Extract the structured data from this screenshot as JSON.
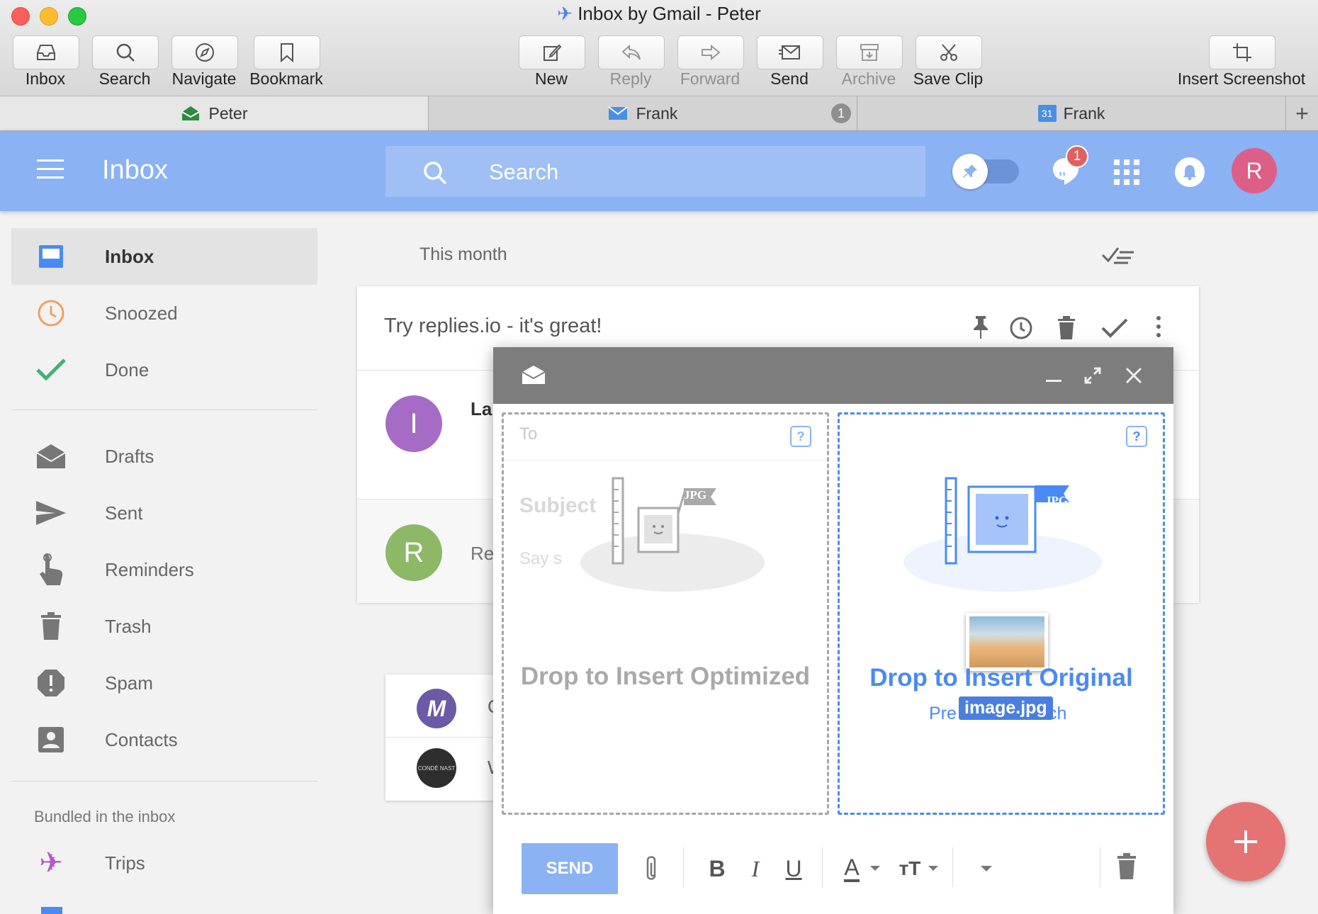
{
  "window": {
    "title": "Inbox by Gmail - Peter"
  },
  "toolbar": {
    "inbox": "Inbox",
    "search": "Search",
    "navigate": "Navigate",
    "bookmark": "Bookmark",
    "new": "New",
    "reply": "Reply",
    "forward": "Forward",
    "send": "Send",
    "archive": "Archive",
    "save_clip": "Save Clip",
    "insert_screenshot": "Insert Screenshot"
  },
  "tabs": [
    {
      "label": "Peter"
    },
    {
      "label": "Frank",
      "badge": "1"
    },
    {
      "label": "Frank",
      "cal_day": "31"
    }
  ],
  "header": {
    "title": "Inbox",
    "search_placeholder": "Search",
    "chat_badge": "1",
    "avatar": "R"
  },
  "sidebar": {
    "items": [
      {
        "label": "Inbox"
      },
      {
        "label": "Snoozed"
      },
      {
        "label": "Done"
      },
      {
        "label": "Drafts"
      },
      {
        "label": "Sent"
      },
      {
        "label": "Reminders"
      },
      {
        "label": "Trash"
      },
      {
        "label": "Spam"
      },
      {
        "label": "Contacts"
      }
    ],
    "section_title": "Bundled in the inbox",
    "bundles": [
      {
        "label": "Trips"
      }
    ]
  },
  "main": {
    "section": "This month",
    "card_subject": "Try replies.io - it's great!",
    "rows": [
      {
        "avatar": "I",
        "snippet": "La"
      },
      {
        "avatar": "R",
        "snippet": "Re"
      }
    ],
    "list2": [
      {
        "snippet": "C"
      },
      {
        "avatar_text": "CONDÉ NAST",
        "snippet": "W"
      }
    ]
  },
  "compose": {
    "to_placeholder": "To",
    "subject_placeholder": "Subject",
    "body_placeholder": "Say s",
    "help": "?",
    "jpg_tag": "JPG",
    "drop_optimized": "Drop to Insert Optimized",
    "drop_original": "Drop to Insert Original",
    "drop_hint_left": "Pre",
    "drop_hint_right": "ch",
    "file_name": "image.jpg",
    "send": "SEND"
  },
  "colors": {
    "appbar": "#8bb2f3",
    "accent_blue": "#4285f4",
    "fab": "#e57373",
    "avatar_r": "#dd5e87"
  }
}
